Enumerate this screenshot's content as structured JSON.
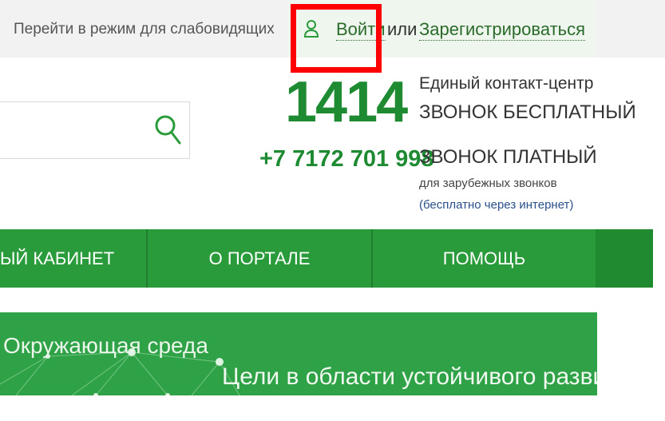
{
  "header": {
    "accessibility_mode": "Перейти в режим для слабовидящих",
    "login": "Войти",
    "or": "или",
    "register": "Зарегистрироваться"
  },
  "search": {
    "icon": "search-icon"
  },
  "contact": {
    "short_number": "1414",
    "center_title": "Единый контакт-центр",
    "free_call": "ЗВОНОК БЕСПЛАТНЫЙ",
    "paid_number": "+7 7172 701 998",
    "paid_call": "ЗВОНОК ПЛАТНЫЙ",
    "foreign_calls": "для зарубежных звонков",
    "free_via_internet": "(бесплатно через интернет)"
  },
  "nav": {
    "items": [
      "ЫЙ КАБИНЕТ",
      "О ПОРТАЛЕ",
      "ПОМОЩЬ"
    ]
  },
  "banner": {
    "left_text": "Окружающая среда",
    "right_text": "Цели в области устойчивого разви"
  },
  "colors": {
    "brand_green": "#2a9b3b",
    "number_green": "#1e8a32",
    "highlight_red": "#ff0000",
    "link_blue": "#2a4f8a"
  }
}
